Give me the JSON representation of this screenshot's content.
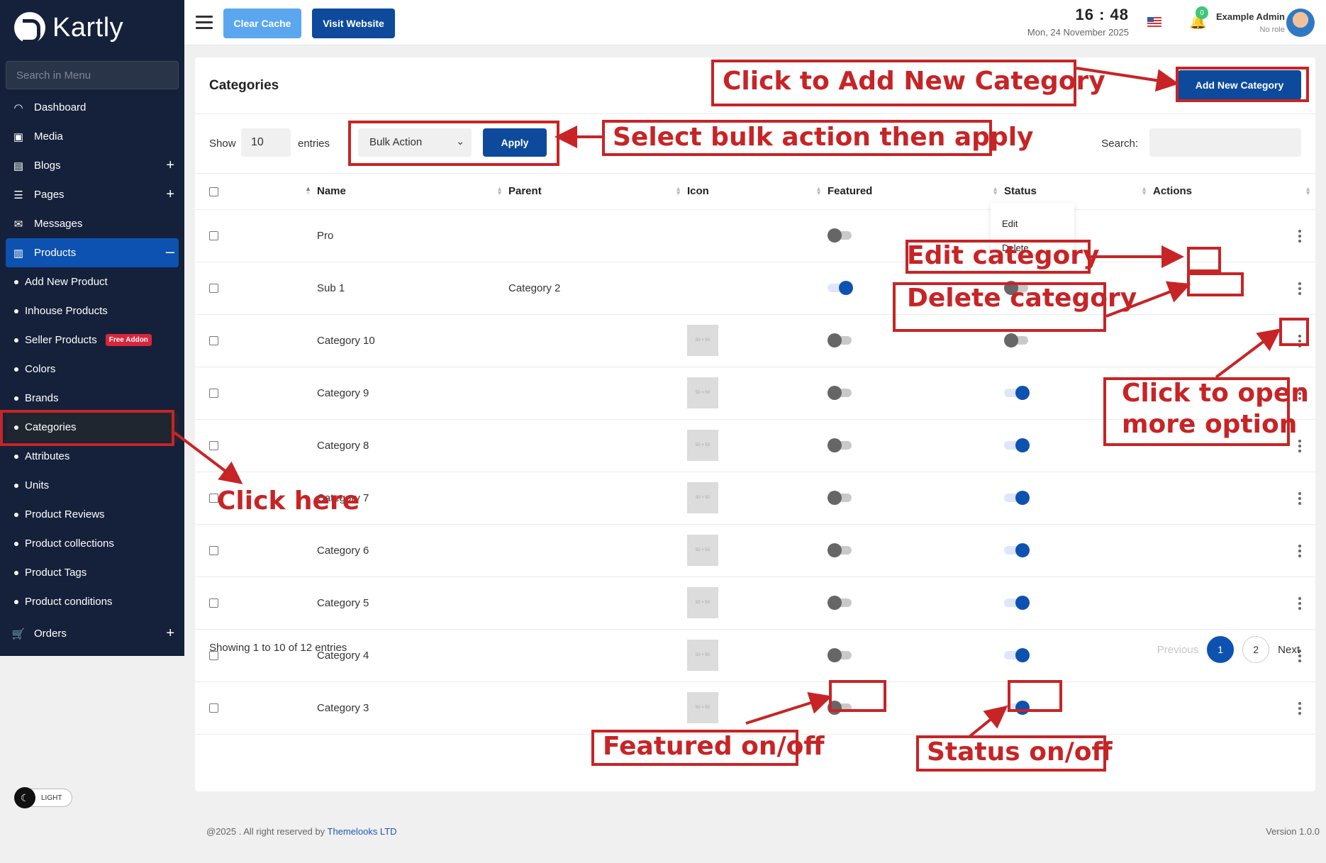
{
  "app": {
    "name": "Kartly"
  },
  "sidebar": {
    "search_placeholder": "Search in Menu",
    "items": [
      {
        "label": "Dashboard",
        "icon": "gauge-icon"
      },
      {
        "label": "Media",
        "icon": "media-icon"
      },
      {
        "label": "Blogs",
        "icon": "blog-icon",
        "expand": "+"
      },
      {
        "label": "Pages",
        "icon": "page-icon",
        "expand": "+"
      },
      {
        "label": "Messages",
        "icon": "inbox-icon"
      },
      {
        "label": "Products",
        "icon": "bag-icon",
        "expand": "–"
      }
    ],
    "subitems": [
      {
        "label": "Add New Product"
      },
      {
        "label": "Inhouse Products"
      },
      {
        "label": "Seller Products",
        "badge": "Free Addon"
      },
      {
        "label": "Colors"
      },
      {
        "label": "Brands"
      },
      {
        "label": "Categories"
      },
      {
        "label": "Attributes"
      },
      {
        "label": "Units"
      },
      {
        "label": "Product Reviews"
      },
      {
        "label": "Product collections"
      },
      {
        "label": "Product Tags"
      },
      {
        "label": "Product conditions"
      }
    ],
    "orders": {
      "label": "Orders",
      "icon": "cart-icon",
      "expand": "+"
    },
    "theme_label": "LIGHT"
  },
  "topbar": {
    "clear_cache": "Clear Cache",
    "visit_website": "Visit Website",
    "time": "16 : 48",
    "date": "Mon, 24 November 2025",
    "notification_count": "0",
    "user_name": "Example Admin",
    "user_role": "No role"
  },
  "page": {
    "title": "Categories",
    "add_button": "Add New Category",
    "show_label": "Show",
    "length_value": "10",
    "entries_label": "entries",
    "bulk_action": "Bulk Action",
    "apply": "Apply",
    "search_label": "Search:"
  },
  "table": {
    "columns": [
      "Name",
      "Parent",
      "Icon",
      "Featured",
      "Status",
      "Actions"
    ],
    "rows": [
      {
        "name": "Pro",
        "parent": "",
        "icon": false,
        "featured": false,
        "status": false
      },
      {
        "name": "Sub 1",
        "parent": "Category 2",
        "icon": false,
        "featured": true,
        "status": false
      },
      {
        "name": "Category 10",
        "parent": "",
        "icon": true,
        "featured": false,
        "status": false
      },
      {
        "name": "Category 9",
        "parent": "",
        "icon": true,
        "featured": false,
        "status": true
      },
      {
        "name": "Category 8",
        "parent": "",
        "icon": true,
        "featured": false,
        "status": true
      },
      {
        "name": "Category 7",
        "parent": "",
        "icon": true,
        "featured": false,
        "status": true
      },
      {
        "name": "Category 6",
        "parent": "",
        "icon": true,
        "featured": false,
        "status": true
      },
      {
        "name": "Category 5",
        "parent": "",
        "icon": true,
        "featured": false,
        "status": true
      },
      {
        "name": "Category 4",
        "parent": "",
        "icon": true,
        "featured": false,
        "status": true
      },
      {
        "name": "Category 3",
        "parent": "",
        "icon": true,
        "featured": false,
        "status": true
      }
    ],
    "placeholder_text": "50 × 50"
  },
  "dropdown": {
    "edit": "Edit",
    "delete": "Delete"
  },
  "pagination": {
    "info": "Showing 1 to 10 of 12 entries",
    "previous": "Previous",
    "pages": [
      "1",
      "2"
    ],
    "next": "Next"
  },
  "footer": {
    "copyright": "@2025 . All right reserved by",
    "company": "Themelooks LTD",
    "version": "Version 1.0.0"
  },
  "annotations": {
    "add_category": "Click to Add New Category",
    "bulk": "Select bulk action then apply",
    "edit": "Edit category",
    "delete": "Delete category",
    "more_options_line1": "Click to open",
    "more_options_line2": "more option",
    "click_here": "Click here",
    "featured": "Featured on/off",
    "status": "Status on/off",
    "color": "#c72426"
  }
}
